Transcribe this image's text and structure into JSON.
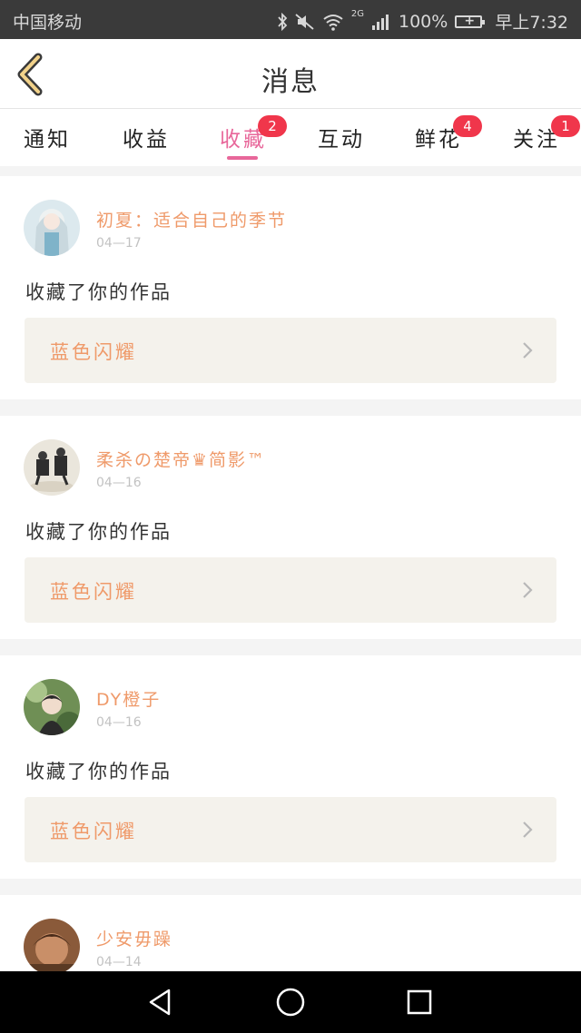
{
  "status_bar": {
    "carrier": "中国移动",
    "network": "2G",
    "battery": "100%",
    "time": "早上7:32"
  },
  "header": {
    "title": "消息",
    "back_icon": "chevron-left-icon"
  },
  "tabs": [
    {
      "label": "通知",
      "badge": ""
    },
    {
      "label": "收益",
      "badge": ""
    },
    {
      "label": "收藏",
      "badge": "2",
      "active": true
    },
    {
      "label": "互动",
      "badge": ""
    },
    {
      "label": "鲜花",
      "badge": "4"
    },
    {
      "label": "关注",
      "badge": "1"
    }
  ],
  "colors": {
    "accent": "#e8679a",
    "badge": "#f0364b",
    "username": "#ef9a6a",
    "work_bg": "#f4f2ec"
  },
  "notifications": [
    {
      "username": "初夏：适合自己的季节",
      "date": "04—17",
      "action": "收藏了你的作品",
      "work_title": "蓝色闪耀"
    },
    {
      "username": "柔杀の楚帝♛简影™",
      "date": "04—16",
      "action": "收藏了你的作品",
      "work_title": "蓝色闪耀"
    },
    {
      "username": "DY橙子",
      "date": "04—16",
      "action": "收藏了你的作品",
      "work_title": "蓝色闪耀"
    },
    {
      "username": "少安毋躁",
      "date": "04—14",
      "action": "",
      "work_title": ""
    }
  ],
  "nav": {
    "back": "triangle-back-icon",
    "home": "circle-home-icon",
    "recents": "square-recents-icon"
  }
}
